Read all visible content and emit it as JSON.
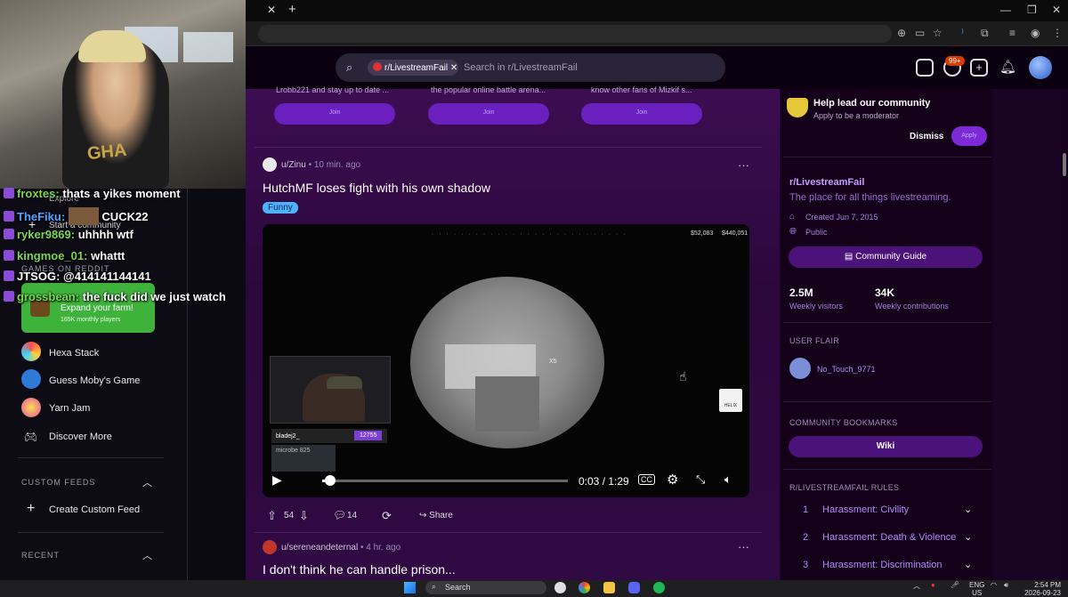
{
  "header": {
    "chip_label": "r/LivestreamFail",
    "search_placeholder": "Search in r/LivestreamFail",
    "notif_count": "99+"
  },
  "cards": [
    {
      "desc": "Lrobb221 and stay up to date ...",
      "button": "Join"
    },
    {
      "desc": "the popular online battle arena...",
      "button": "Join"
    },
    {
      "desc": "know other fans of Mizkif s...",
      "button": "Join"
    }
  ],
  "post1": {
    "author": "u/Zinu",
    "time": "• 10 min. ago",
    "title": "HutchMF loses fight with his own shadow",
    "flair": "Funny",
    "video": {
      "time": "0:03 / 1:29",
      "progress": 0.034,
      "money1": "$52,083",
      "money2": "$440,051",
      "zoom": "X5",
      "cam_name": "bladej2_",
      "cam_score": "12755",
      "cam_name2": "microbe 825",
      "brand": "HELIX"
    },
    "votes": "54",
    "comments": "14",
    "share": "Share"
  },
  "post2": {
    "author": "u/sereneandeternal",
    "time": "• 4 hr. ago",
    "title": "I don't think he can handle prison..."
  },
  "sidebar": {
    "help_title": "Help lead our community",
    "help_sub": "Apply to be a moderator",
    "dismiss": "Dismiss",
    "apply": "Apply",
    "sub_name": "r/LivestreamFail",
    "sub_desc": "The place for all things livestreaming.",
    "created": "Created Jun 7, 2015",
    "visibility": "Public",
    "guide_btn": "Community Guide",
    "visitors": "2.5M",
    "visitors_label": "Weekly visitors",
    "contribs": "34K",
    "contribs_label": "Weekly contributions",
    "user_flair_label": "USER FLAIR",
    "user_flair": "No_Touch_9771",
    "bookmarks_label": "COMMUNITY BOOKMARKS",
    "wiki": "Wiki",
    "rules_label": "R/LIVESTREAMFAIL RULES",
    "rules": [
      {
        "num": "1",
        "text": "Harassment: Civility"
      },
      {
        "num": "2",
        "text": "Harassment: Death & Violence"
      },
      {
        "num": "3",
        "text": "Harassment: Discrimination"
      }
    ]
  },
  "chat": [
    {
      "name": "froxtes:",
      "msg": "thats a yikes moment"
    },
    {
      "name": "TheFiku:",
      "msg": "CUCK22"
    },
    {
      "name": "ryker9869:",
      "msg": "uhhhh wtf"
    },
    {
      "name": "kingmoe_01:",
      "msg": "whattt"
    },
    {
      "name": "JTSOG:",
      "msg": "@414141144141"
    },
    {
      "name": "grossbean:",
      "msg": "the fuck did we just watch"
    }
  ],
  "leftnav": {
    "explore": "Explore",
    "start_community": "Start a community",
    "games_label": "GAMES ON REDDIT",
    "promo_title": "Expand your farm!",
    "promo_sub": "165K monthly players",
    "games": [
      "Hexa Stack",
      "Guess Moby's Game",
      "Yarn Jam"
    ],
    "discover": "Discover More",
    "custom_feeds_label": "CUSTOM FEEDS",
    "create_feed": "Create Custom Feed",
    "recent_label": "RECENT"
  },
  "stream": {
    "shirt_text": "GHA"
  },
  "taskbar": {
    "search": "Search",
    "lang1": "ENG",
    "lang2": "US",
    "time": "2:54 PM",
    "date": "2026-09-23"
  }
}
